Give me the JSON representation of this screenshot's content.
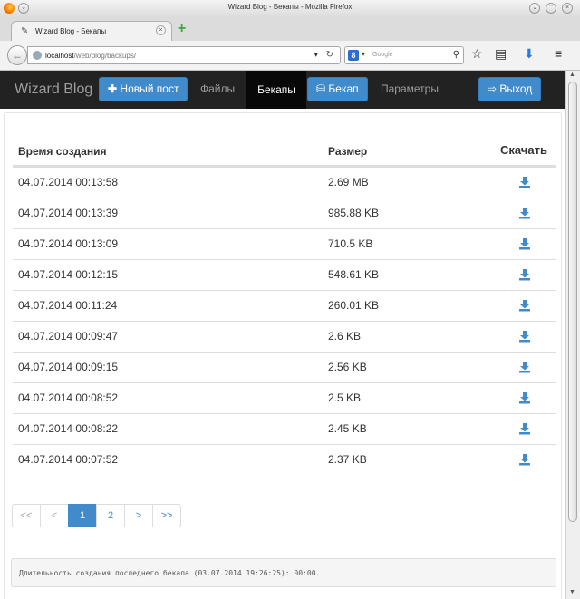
{
  "window": {
    "title": "Wizard Blog - Бекапы - Mozilla Firefox"
  },
  "browser": {
    "tab_title": "Wizard Blog - Бекапы",
    "url_host": "localhost",
    "url_path": "/web/blog/backups/",
    "search_placeholder": "Google"
  },
  "app": {
    "brand": "Wizard Blog",
    "nav": {
      "new_post": "Новый пост",
      "files": "Файлы",
      "backups": "Бекапы",
      "backup_button": "Бекап",
      "settings": "Параметры",
      "logout": "Выход"
    }
  },
  "table": {
    "headers": {
      "created": "Время создания",
      "size": "Размер",
      "download": "Скачать"
    },
    "rows": [
      {
        "time": "04.07.2014 00:13:58",
        "size": "2.69 MB"
      },
      {
        "time": "04.07.2014 00:13:39",
        "size": "985.88 KB"
      },
      {
        "time": "04.07.2014 00:13:09",
        "size": "710.5 KB"
      },
      {
        "time": "04.07.2014 00:12:15",
        "size": "548.61 KB"
      },
      {
        "time": "04.07.2014 00:11:24",
        "size": "260.01 KB"
      },
      {
        "time": "04.07.2014 00:09:47",
        "size": "2.6 KB"
      },
      {
        "time": "04.07.2014 00:09:15",
        "size": "2.56 KB"
      },
      {
        "time": "04.07.2014 00:08:52",
        "size": "2.5 KB"
      },
      {
        "time": "04.07.2014 00:08:22",
        "size": "2.45 KB"
      },
      {
        "time": "04.07.2014 00:07:52",
        "size": "2.37 KB"
      }
    ]
  },
  "pagination": {
    "first": "<<",
    "prev": "<",
    "page1": "1",
    "page2": "2",
    "next": ">",
    "last": ">>"
  },
  "footer_note": "Длительность создания последнего бекапа (03.07.2014 19:26:25): 00:00.",
  "colors": {
    "primary": "#428bca",
    "navbar": "#222222"
  }
}
